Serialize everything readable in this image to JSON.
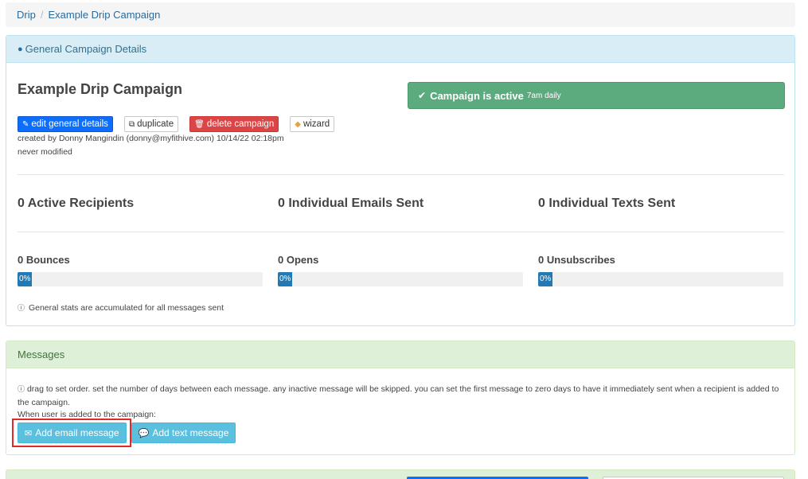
{
  "breadcrumb": {
    "root": "Drip",
    "separator": "/",
    "current": "Example Drip Campaign"
  },
  "general": {
    "heading": "General Campaign Details",
    "title": "Example Drip Campaign",
    "status": {
      "check": "✔",
      "label": "Campaign is active",
      "schedule": "7am daily",
      "color": "#5bab7f"
    },
    "buttons": {
      "edit": "edit general details",
      "duplicate": "duplicate",
      "delete": "delete campaign",
      "wizard": "wizard"
    },
    "created": "created by Donny Mangindin (donny@myfithive.com) 10/14/22 02:18pm",
    "modified": "never modified",
    "stats": [
      {
        "label": "0 Active Recipients"
      },
      {
        "label": "0 Individual Emails Sent"
      },
      {
        "label": "0 Individual Texts Sent"
      }
    ],
    "rates": [
      {
        "label": "0 Bounces",
        "percent_text": "0%",
        "percent": 0
      },
      {
        "label": "0 Opens",
        "percent_text": "0%",
        "percent": 0
      },
      {
        "label": "0 Unsubscribes",
        "percent_text": "0%",
        "percent": 0
      }
    ],
    "note": "General stats are accumulated for all messages sent"
  },
  "messages": {
    "heading": "Messages",
    "note": "drag to set order. set the number of days between each message. any inactive message will be skipped. you can set the first message to zero days to have it immediately sent when a recipient is added to the campaign.",
    "when": "When user is added to the campaign:",
    "add_email": "Add email message",
    "add_text": "Add text message"
  },
  "icons": {
    "drop": "droplet-icon",
    "check": "check-icon",
    "edit": "edit-icon",
    "copy": "copy-icon",
    "trash": "trash-icon",
    "wizard": "wizard-icon",
    "info": "info-icon",
    "envelope": "envelope-icon",
    "chat": "chat-icon"
  }
}
